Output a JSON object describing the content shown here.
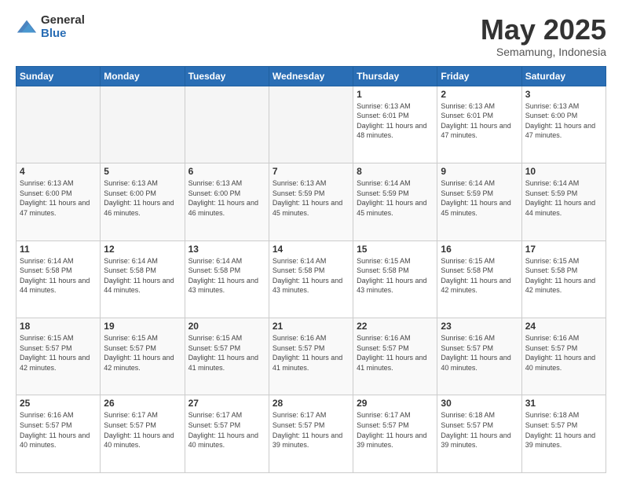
{
  "logo": {
    "general": "General",
    "blue": "Blue"
  },
  "header": {
    "title": "May 2025",
    "subtitle": "Semamung, Indonesia"
  },
  "weekdays": [
    "Sunday",
    "Monday",
    "Tuesday",
    "Wednesday",
    "Thursday",
    "Friday",
    "Saturday"
  ],
  "weeks": [
    [
      {
        "day": "",
        "empty": true
      },
      {
        "day": "",
        "empty": true
      },
      {
        "day": "",
        "empty": true
      },
      {
        "day": "",
        "empty": true
      },
      {
        "day": "1",
        "sunrise": "6:13 AM",
        "sunset": "6:01 PM",
        "daylight": "11 hours and 48 minutes."
      },
      {
        "day": "2",
        "sunrise": "6:13 AM",
        "sunset": "6:01 PM",
        "daylight": "11 hours and 47 minutes."
      },
      {
        "day": "3",
        "sunrise": "6:13 AM",
        "sunset": "6:00 PM",
        "daylight": "11 hours and 47 minutes."
      }
    ],
    [
      {
        "day": "4",
        "sunrise": "6:13 AM",
        "sunset": "6:00 PM",
        "daylight": "11 hours and 47 minutes."
      },
      {
        "day": "5",
        "sunrise": "6:13 AM",
        "sunset": "6:00 PM",
        "daylight": "11 hours and 46 minutes."
      },
      {
        "day": "6",
        "sunrise": "6:13 AM",
        "sunset": "6:00 PM",
        "daylight": "11 hours and 46 minutes."
      },
      {
        "day": "7",
        "sunrise": "6:13 AM",
        "sunset": "5:59 PM",
        "daylight": "11 hours and 45 minutes."
      },
      {
        "day": "8",
        "sunrise": "6:14 AM",
        "sunset": "5:59 PM",
        "daylight": "11 hours and 45 minutes."
      },
      {
        "day": "9",
        "sunrise": "6:14 AM",
        "sunset": "5:59 PM",
        "daylight": "11 hours and 45 minutes."
      },
      {
        "day": "10",
        "sunrise": "6:14 AM",
        "sunset": "5:59 PM",
        "daylight": "11 hours and 44 minutes."
      }
    ],
    [
      {
        "day": "11",
        "sunrise": "6:14 AM",
        "sunset": "5:58 PM",
        "daylight": "11 hours and 44 minutes."
      },
      {
        "day": "12",
        "sunrise": "6:14 AM",
        "sunset": "5:58 PM",
        "daylight": "11 hours and 44 minutes."
      },
      {
        "day": "13",
        "sunrise": "6:14 AM",
        "sunset": "5:58 PM",
        "daylight": "11 hours and 43 minutes."
      },
      {
        "day": "14",
        "sunrise": "6:14 AM",
        "sunset": "5:58 PM",
        "daylight": "11 hours and 43 minutes."
      },
      {
        "day": "15",
        "sunrise": "6:15 AM",
        "sunset": "5:58 PM",
        "daylight": "11 hours and 43 minutes."
      },
      {
        "day": "16",
        "sunrise": "6:15 AM",
        "sunset": "5:58 PM",
        "daylight": "11 hours and 42 minutes."
      },
      {
        "day": "17",
        "sunrise": "6:15 AM",
        "sunset": "5:58 PM",
        "daylight": "11 hours and 42 minutes."
      }
    ],
    [
      {
        "day": "18",
        "sunrise": "6:15 AM",
        "sunset": "5:57 PM",
        "daylight": "11 hours and 42 minutes."
      },
      {
        "day": "19",
        "sunrise": "6:15 AM",
        "sunset": "5:57 PM",
        "daylight": "11 hours and 42 minutes."
      },
      {
        "day": "20",
        "sunrise": "6:15 AM",
        "sunset": "5:57 PM",
        "daylight": "11 hours and 41 minutes."
      },
      {
        "day": "21",
        "sunrise": "6:16 AM",
        "sunset": "5:57 PM",
        "daylight": "11 hours and 41 minutes."
      },
      {
        "day": "22",
        "sunrise": "6:16 AM",
        "sunset": "5:57 PM",
        "daylight": "11 hours and 41 minutes."
      },
      {
        "day": "23",
        "sunrise": "6:16 AM",
        "sunset": "5:57 PM",
        "daylight": "11 hours and 40 minutes."
      },
      {
        "day": "24",
        "sunrise": "6:16 AM",
        "sunset": "5:57 PM",
        "daylight": "11 hours and 40 minutes."
      }
    ],
    [
      {
        "day": "25",
        "sunrise": "6:16 AM",
        "sunset": "5:57 PM",
        "daylight": "11 hours and 40 minutes."
      },
      {
        "day": "26",
        "sunrise": "6:17 AM",
        "sunset": "5:57 PM",
        "daylight": "11 hours and 40 minutes."
      },
      {
        "day": "27",
        "sunrise": "6:17 AM",
        "sunset": "5:57 PM",
        "daylight": "11 hours and 40 minutes."
      },
      {
        "day": "28",
        "sunrise": "6:17 AM",
        "sunset": "5:57 PM",
        "daylight": "11 hours and 39 minutes."
      },
      {
        "day": "29",
        "sunrise": "6:17 AM",
        "sunset": "5:57 PM",
        "daylight": "11 hours and 39 minutes."
      },
      {
        "day": "30",
        "sunrise": "6:18 AM",
        "sunset": "5:57 PM",
        "daylight": "11 hours and 39 minutes."
      },
      {
        "day": "31",
        "sunrise": "6:18 AM",
        "sunset": "5:57 PM",
        "daylight": "11 hours and 39 minutes."
      }
    ]
  ]
}
